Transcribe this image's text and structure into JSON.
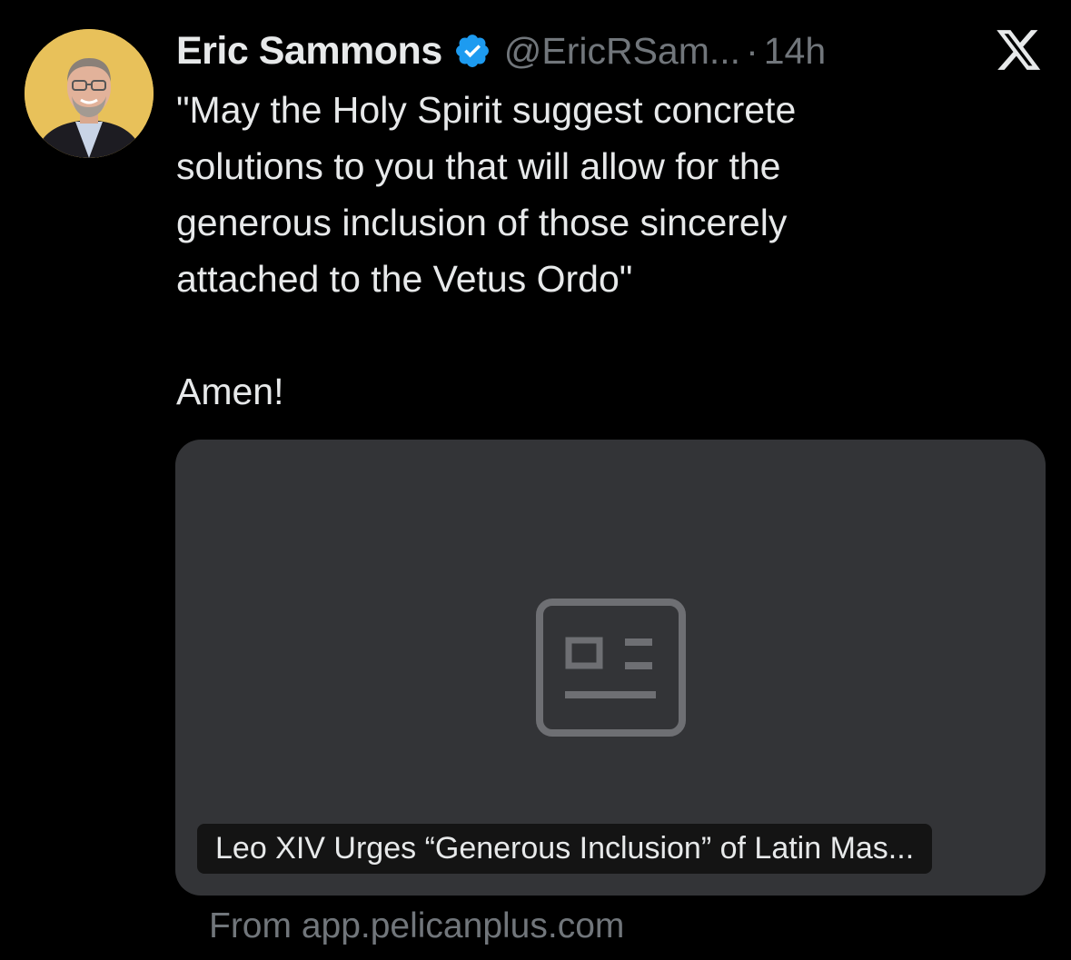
{
  "tweet": {
    "display_name": "Eric Sammons",
    "handle": "@EricRSam...",
    "separator": "·",
    "time": "14h",
    "text": "\"May the Holy Spirit suggest concrete\nsolutions to you that will allow for the\ngenerous inclusion of those sincerely\nattached to the Vetus Ordo\"",
    "text_amen": "Amen!"
  },
  "link_card": {
    "title": "Leo XIV Urges “Generous Inclusion” of Latin Mas...",
    "source": "From app.pelicanplus.com",
    "icon": "article-placeholder-icon"
  },
  "icons": {
    "verified": "verified-badge-icon",
    "logo": "x-logo-icon"
  },
  "colors": {
    "background": "#000000",
    "text_primary": "#e7e9ea",
    "text_secondary": "#71767b",
    "verified": "#1d9bf0",
    "card_bg": "#333437"
  }
}
